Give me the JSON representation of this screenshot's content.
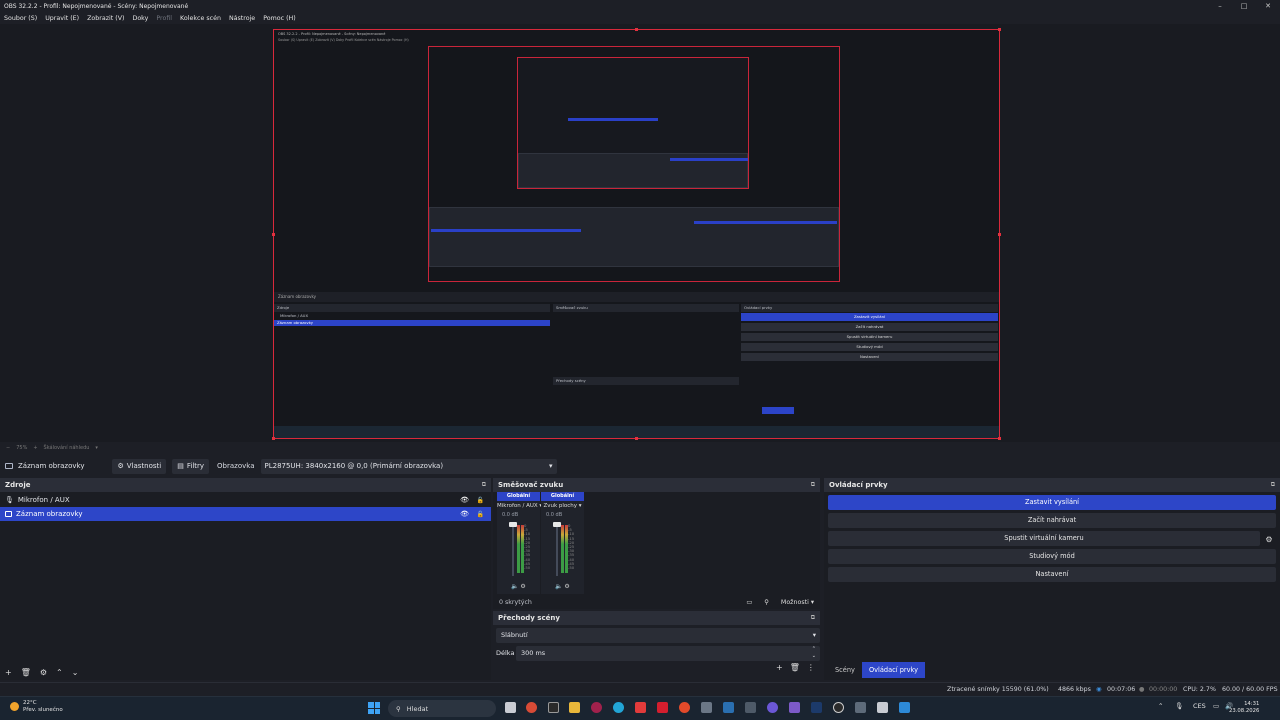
{
  "window": {
    "title": "OBS 32.2.2 - Profil: Nepojmenované - Scény: Nepojmenované",
    "controls": [
      "–",
      "□",
      "✕"
    ]
  },
  "menu": [
    {
      "label": "Soubor (S)",
      "enabled": true
    },
    {
      "label": "Upravit (E)",
      "enabled": true
    },
    {
      "label": "Zobrazit (V)",
      "enabled": true
    },
    {
      "label": "Doky",
      "enabled": true
    },
    {
      "label": "Profil",
      "enabled": false
    },
    {
      "label": "Kolekce scén",
      "enabled": true
    },
    {
      "label": "Nástroje",
      "enabled": true
    },
    {
      "label": "Pomoc (H)",
      "enabled": true
    }
  ],
  "zoom": {
    "value": "75%",
    "label": "Škálování náhledu"
  },
  "source_toolbar": {
    "source_name": "Záznam obrazovky",
    "properties_label": "Vlastnosti",
    "filters_label": "Filtry",
    "display_label": "Obrazovka",
    "display_value": "PL2875UH: 3840x2160 @ 0,0 (Primární obrazovka)"
  },
  "sources": {
    "title": "Zdroje",
    "items": [
      {
        "label": "Mikrofon / AUX",
        "selected": false
      },
      {
        "label": "Záznam obrazovky",
        "selected": true
      }
    ]
  },
  "mixer": {
    "title": "Směšovač zvuku",
    "channels": [
      {
        "global": "Globální",
        "name": "Mikrofon / AUX ▾",
        "db": "0.0 dB"
      },
      {
        "global": "Globální",
        "name": "Zvuk plochy ▾",
        "db": "0.0 dB"
      }
    ],
    "ticks": [
      "0",
      "-5",
      "-10",
      "-15",
      "-20",
      "-25",
      "-30",
      "-35",
      "-40",
      "-45",
      "-50",
      "-55",
      "-60"
    ],
    "hidden": "0 skrytých",
    "options": "Možnosti ▾"
  },
  "transitions": {
    "title": "Přechody scény",
    "selected": "Slábnutí",
    "duration_label": "Délka",
    "duration_value": "300 ms"
  },
  "controls": {
    "title": "Ovládací prvky",
    "buttons": [
      {
        "label": "Zastavit vysílání",
        "active": true
      },
      {
        "label": "Začít nahrávat",
        "active": false
      },
      {
        "label": "Spustit virtuální kameru",
        "active": false
      },
      {
        "label": "Studiový mód",
        "active": false
      },
      {
        "label": "Nastavení",
        "active": false
      }
    ],
    "tabs": [
      {
        "label": "Scény",
        "active": false
      },
      {
        "label": "Ovládací prvky",
        "active": true
      }
    ]
  },
  "statusbar": {
    "dropped": "Ztracené snímky 15590 (61.0%)",
    "kbps": "4866 kbps",
    "live_time": "00:07:06",
    "rec_time": "00:00:00",
    "cpu": "CPU: 2.7%",
    "fps": "60.00 / 60.00 FPS"
  },
  "taskbar": {
    "weather_temp": "22°C",
    "weather_desc": "Přev. slunečno",
    "search_placeholder": "Hledat",
    "lang": "CES",
    "time": "14:31",
    "date": "23.08.2026"
  },
  "nested": {
    "title": "OBS 32.2.2 - Profil: Nepojmenované - Scény: Nepojmenované",
    "menu": "Soubor (S)  Upravit (E)  Zobrazit (V)  Doky  Profil  Kolekce scén  Nástroje  Pomoc (H)",
    "source_name": "Záznam obrazovky",
    "sources_title": "Zdroje",
    "src1": "Mikrofon / AUX",
    "src2": "Záznam obrazovky",
    "mixer_title": "Směšovač zvuku",
    "transitions_title": "Přechody scény",
    "controls_title": "Ovládací prvky",
    "btn1": "Zastavit vysílání",
    "btn2": "Začít nahrávat",
    "btn3": "Spustit virtuální kameru",
    "btn4": "Studiový mód",
    "btn5": "Nastavení"
  },
  "colors": {
    "accent": "#2d46c8",
    "selection_border": "#d8293b",
    "background": "#1d1f26"
  }
}
